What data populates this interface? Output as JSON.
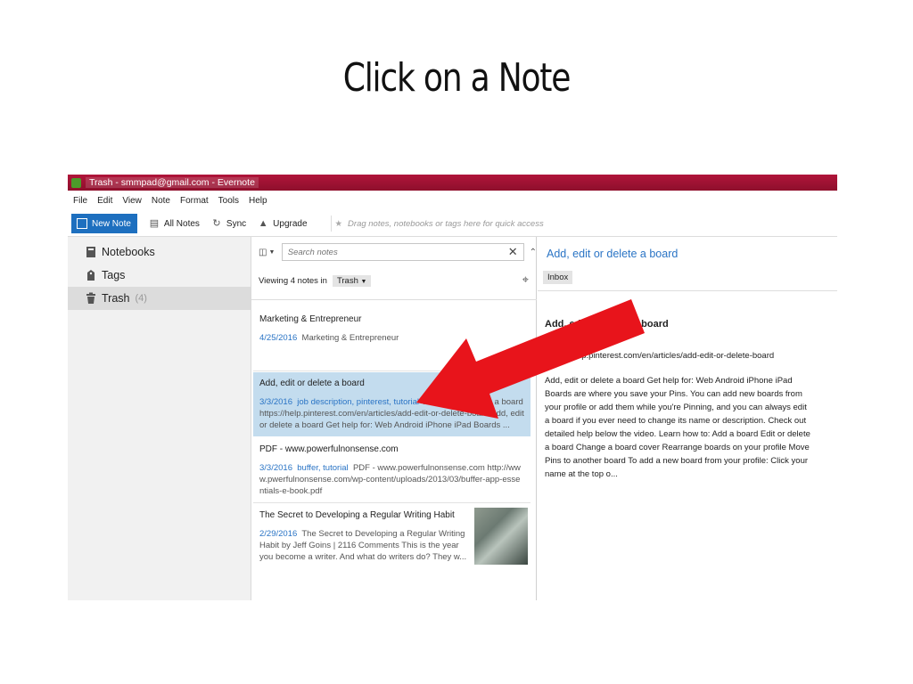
{
  "slide": {
    "title": "Click on a Note"
  },
  "window": {
    "title": "Trash - smmpad@gmail.com - Evernote"
  },
  "menu": [
    "File",
    "Edit",
    "View",
    "Note",
    "Format",
    "Tools",
    "Help"
  ],
  "toolbar": {
    "new_note": "New Note",
    "all_notes": "All Notes",
    "sync": "Sync",
    "upgrade": "Upgrade",
    "shortcut_placeholder": "Drag notes, notebooks or tags here for quick access"
  },
  "sidebar": {
    "items": [
      {
        "label": "Notebooks",
        "icon": "notebook-icon"
      },
      {
        "label": "Tags",
        "icon": "tag-icon"
      },
      {
        "label": "Trash",
        "icon": "trash-icon",
        "count": "(4)"
      }
    ]
  },
  "notelist": {
    "search_placeholder": "Search notes",
    "viewing_prefix": "Viewing 4 notes in",
    "viewing_scope": "Trash",
    "notes": [
      {
        "title": "Marketing & Entrepreneur",
        "date": "4/25/2016",
        "tags": "",
        "snippet": "Marketing & Entrepreneur"
      },
      {
        "title": "Add, edit or delete a board",
        "date": "3/3/2016",
        "tags": "job description, pinterest, tutorial",
        "snippet": "Add, edit or delete a board https://help.pinterest.com/en/articles/add-edit-or-delete-board Add, edit or delete a board Get help for: Web Android iPhone iPad Boards ..."
      },
      {
        "title": "PDF - www.powerfulnonsense.com",
        "date": "3/3/2016",
        "tags": "buffer, tutorial",
        "snippet": "PDF - www.powerfulnonsense.com http://www.pwerfulnonsense.com/wp-content/uploads/2013/03/buffer-app-essentials-e-book.pdf"
      },
      {
        "title": "The Secret to Developing a Regular Writing Habit",
        "date": "2/29/2016",
        "tags": "",
        "snippet": "The Secret to Developing a Regular Writing Habit by Jeff Goins | 2116 Comments This is the year you become a writer. And what do writers do? They w..."
      }
    ]
  },
  "preview": {
    "title": "Add, edit or delete a board",
    "notebook": "Inbox",
    "heading": "Add, edit or delete a board",
    "url": "https://help.pinterest.com/en/articles/add-edit-or-delete-board",
    "body": "Add, edit or delete a board Get help for: Web Android iPhone iPad Boards are where you save your Pins. You can add new boards from your profile or add them while you're Pinning, and you can always edit a board if you ever need to change its name or description. Check out detailed help below the video. Learn how to: Add a board Edit or delete a board Change a board cover Rearrange boards on your profile Move Pins to another board To add a new board from your profile: Click your name at the top o..."
  },
  "colors": {
    "accent": "#2a74c5",
    "titlebar": "#a31234",
    "selection": "#c3dcee",
    "arrow": "#e8141b"
  }
}
